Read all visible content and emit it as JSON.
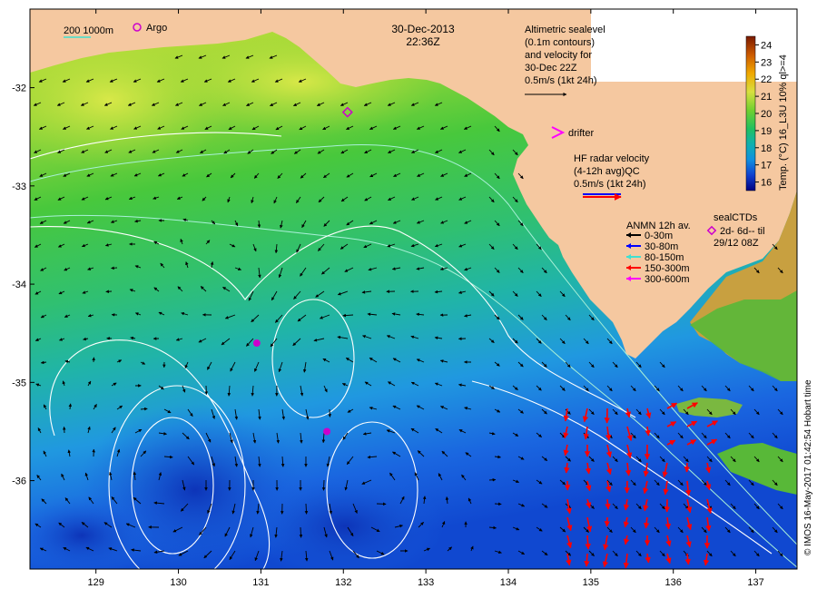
{
  "header": {
    "date": "30-Dec-2013",
    "time": "22:36Z"
  },
  "bathymetry_legend": {
    "depths": "200 1000m"
  },
  "argo_legend": {
    "label": "Argo"
  },
  "altimetry_legend": {
    "lines": [
      "Altimetric sealevel",
      "(0.1m contours)",
      "and velocity for",
      "30-Dec 22Z",
      "0.5m/s (1kt 24h)"
    ]
  },
  "drifter_legend": {
    "label": "drifter"
  },
  "hf_radar_legend": {
    "lines": [
      "HF radar velocity",
      "(4-12h avg)QC",
      "0.5m/s (1kt 24h)"
    ]
  },
  "anmn_legend": {
    "title": "ANMN 12h av.",
    "items": [
      {
        "label": "0-30m",
        "color": "#000000"
      },
      {
        "label": "30-80m",
        "color": "#0000ff"
      },
      {
        "label": "80-150m",
        "color": "#40e0d0"
      },
      {
        "label": "150-300m",
        "color": "#ff0000"
      },
      {
        "label": "300-600m",
        "color": "#ff00ff"
      }
    ]
  },
  "sealctd_legend": {
    "lines": [
      "sealCTDs",
      "2d- 6d-- til",
      "29/12 08Z"
    ]
  },
  "colorbar": {
    "title": "Temp. (°C) 16_L3U 10% ql>=4",
    "ticks": [
      "16",
      "17",
      "18",
      "19",
      "20",
      "21",
      "22",
      "23",
      "24"
    ],
    "min": 15.5,
    "max": 24.5
  },
  "credit": "© IMOS 16-May-2017 01:42:54 Hobart time",
  "axes": {
    "x_ticks": [
      129,
      130,
      131,
      132,
      133,
      134,
      135,
      136,
      137
    ],
    "y_ticks": [
      -32,
      -33,
      -34,
      -35,
      -36
    ],
    "lon_range": [
      128.2,
      137.5
    ],
    "lat_range": [
      -36.9,
      -31.2
    ]
  },
  "colors": {
    "land": "#f5c8a0",
    "argo_marker": "#cc00cc",
    "drifter": "#ff00ff",
    "hf_radar": "#ff0000"
  },
  "argo_floats": [
    {
      "lon": 130.95,
      "lat": -34.6
    },
    {
      "lon": 131.8,
      "lat": -35.5
    }
  ],
  "seal_ctd": {
    "lon": 132.05,
    "lat": -32.25
  }
}
